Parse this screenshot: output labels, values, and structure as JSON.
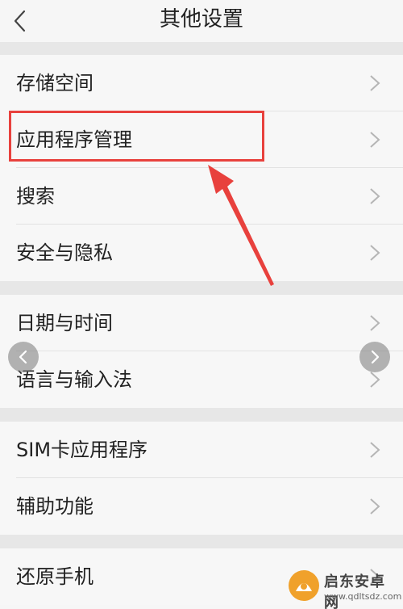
{
  "header": {
    "title": "其他设置"
  },
  "groups": [
    {
      "items": [
        {
          "label": "存储空间"
        },
        {
          "label": "应用程序管理"
        },
        {
          "label": "搜索"
        },
        {
          "label": "安全与隐私"
        }
      ]
    },
    {
      "items": [
        {
          "label": "日期与时间"
        },
        {
          "label": "语言与输入法"
        }
      ]
    },
    {
      "items": [
        {
          "label": "SIM卡应用程序"
        },
        {
          "label": "辅助功能"
        }
      ]
    },
    {
      "items": [
        {
          "label": "还原手机"
        }
      ]
    }
  ],
  "annotation": {
    "highlight_color": "#e8413d"
  },
  "watermark": {
    "name": "启东安卓网",
    "url": "www.qdltsdz.com"
  },
  "icons": {
    "back": "chevron-left-icon",
    "row": "chevron-right-icon",
    "prev": "prev-circle-icon",
    "next": "next-circle-icon"
  }
}
